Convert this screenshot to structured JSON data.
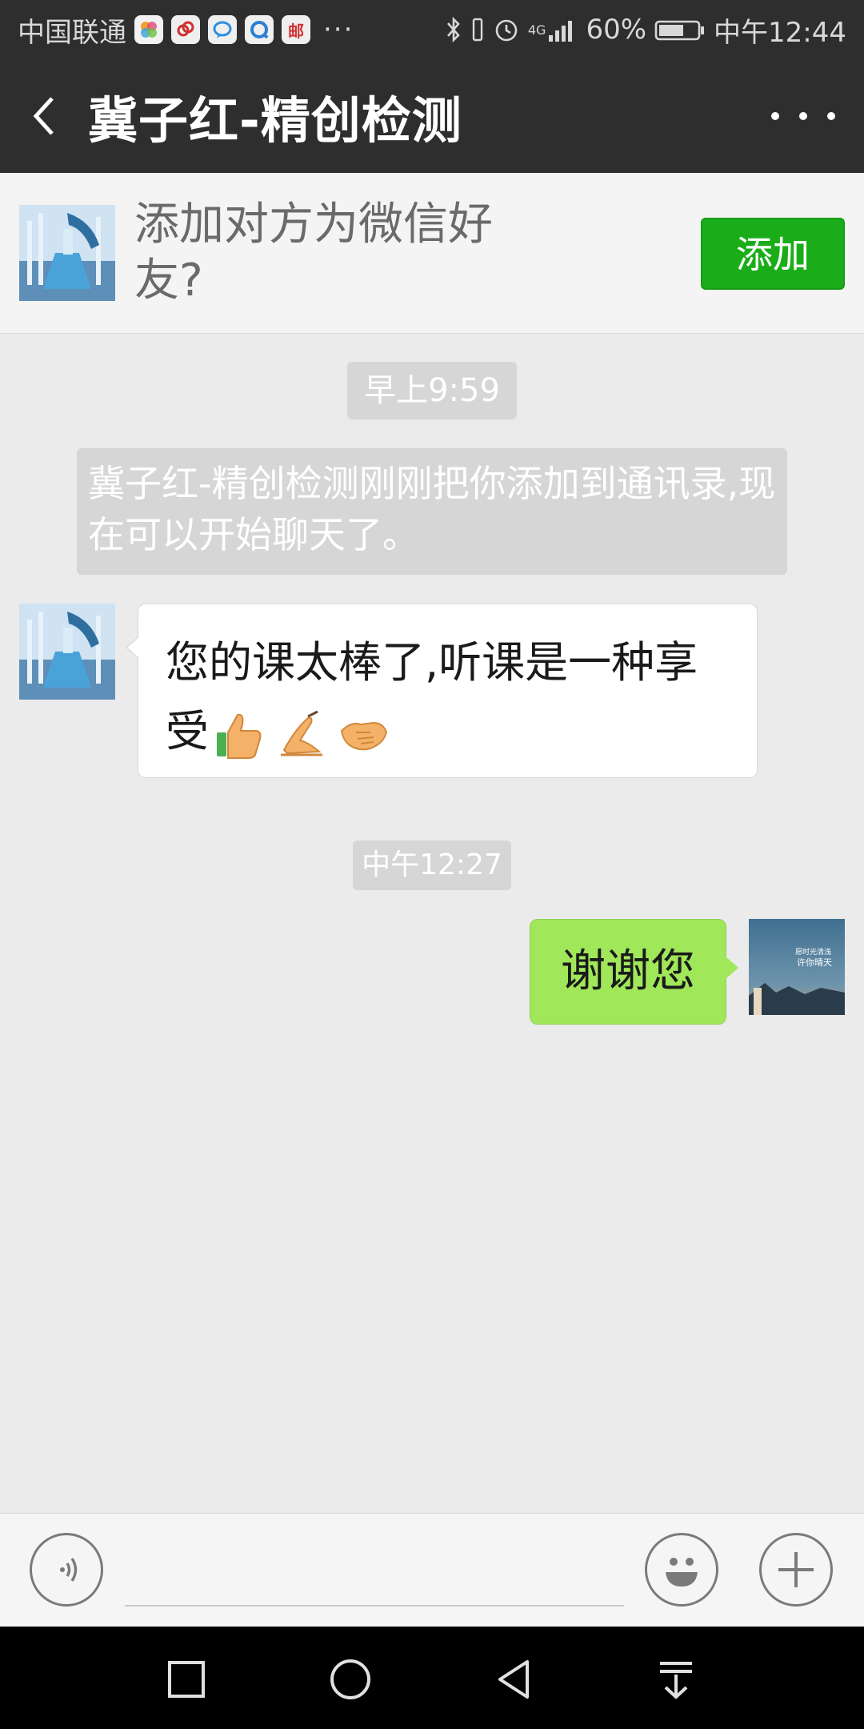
{
  "status_bar": {
    "carrier": "中国联通",
    "app_icons": [
      "photos-icon",
      "link-app-icon",
      "chat-app-icon",
      "browser-app-icon",
      "mail-app-icon"
    ],
    "mail_icon_label": "邮",
    "more": "···",
    "network": "4G",
    "battery_percent": "60%",
    "time": "中午12:44"
  },
  "header": {
    "title": "冀子红-精创检测"
  },
  "banner": {
    "prompt": "添加对方为微信好友?",
    "add_label": "添加"
  },
  "chat": {
    "time_1": "早上9:59",
    "system_message": "冀子红-精创检测刚刚把你添加到通讯录,现在可以开始聊天了。",
    "incoming_text": "您的课太棒了,听课是一种享受",
    "incoming_emojis": [
      "thumbs-up-icon",
      "pen-writing-icon",
      "handshake-icon"
    ],
    "time_2": "中午12:27",
    "outgoing_text": "谢谢您",
    "self_avatar_text": [
      "愿时光清浅",
      "许你晴天"
    ]
  },
  "colors": {
    "header_bg": "#2e2e2e",
    "add_button": "#1aad19",
    "outgoing_bubble": "#a0e75a",
    "chat_bg": "#ebebeb"
  }
}
